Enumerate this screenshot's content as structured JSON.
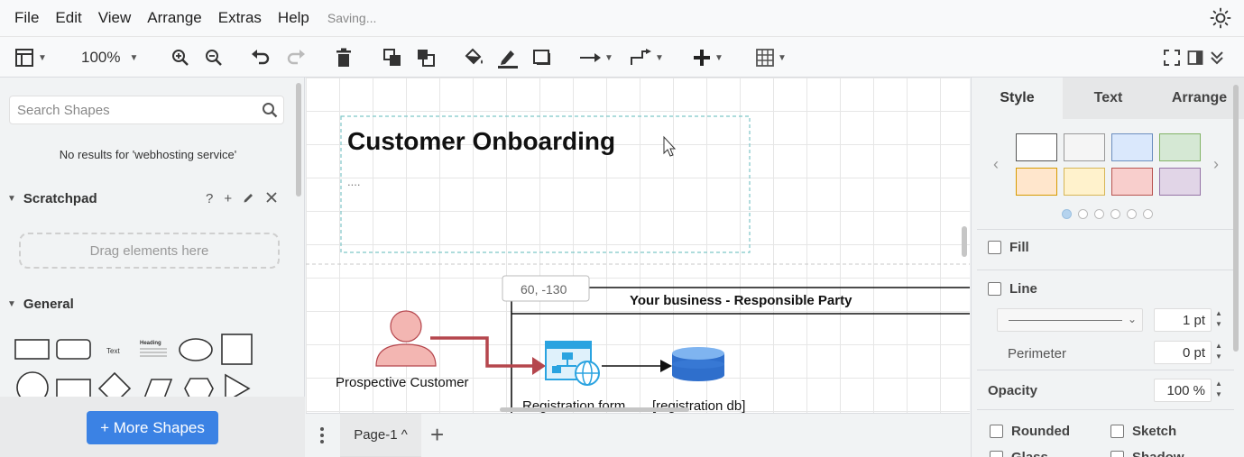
{
  "menu": {
    "items": [
      "File",
      "Edit",
      "View",
      "Arrange",
      "Extras",
      "Help"
    ],
    "status": "Saving..."
  },
  "toolbar": {
    "zoom": "100%"
  },
  "sidebar": {
    "search_placeholder": "Search Shapes",
    "no_results": "No results for 'webhosting service'",
    "scratchpad_title": "Scratchpad",
    "scratchpad_tools": [
      "?",
      "+"
    ],
    "drop_hint": "Drag elements here",
    "general_title": "General",
    "shape_text_label": "Text",
    "shape_heading_label": "Heading",
    "more_shapes": "+ More Shapes"
  },
  "canvas": {
    "title": "Customer Onboarding",
    "title_placeholder": "....",
    "coord_tooltip": "60, -130",
    "pool_title": "Your business - Responsible Party",
    "actor_label": "Prospective Customer",
    "form_label": "Registration form",
    "db_label": "[registration db]"
  },
  "pages": {
    "current": "Page-1 ^",
    "add": "+"
  },
  "format_panel": {
    "tabs": [
      "Style",
      "Text",
      "Arrange"
    ],
    "swatches": [
      "#ffffff",
      "#f5f5f5",
      "#dae8fc",
      "#d5e8d4",
      "#ffe6cc",
      "#fff2cc",
      "#f8cecc",
      "#e1d5e7"
    ],
    "fill_label": "Fill",
    "line_label": "Line",
    "line_width": "1 pt",
    "perimeter_label": "Perimeter",
    "perimeter_value": "0 pt",
    "opacity_label": "Opacity",
    "opacity_value": "100 %",
    "rounded_label": "Rounded",
    "sketch_label": "Sketch",
    "glass_label": "Glass",
    "shadow_label": "Shadow"
  },
  "colors": {
    "accent": "#3b82e4",
    "connector": "#b5464d",
    "actor_fill": "#f3b6b2",
    "selection": "#7ec6c8"
  }
}
